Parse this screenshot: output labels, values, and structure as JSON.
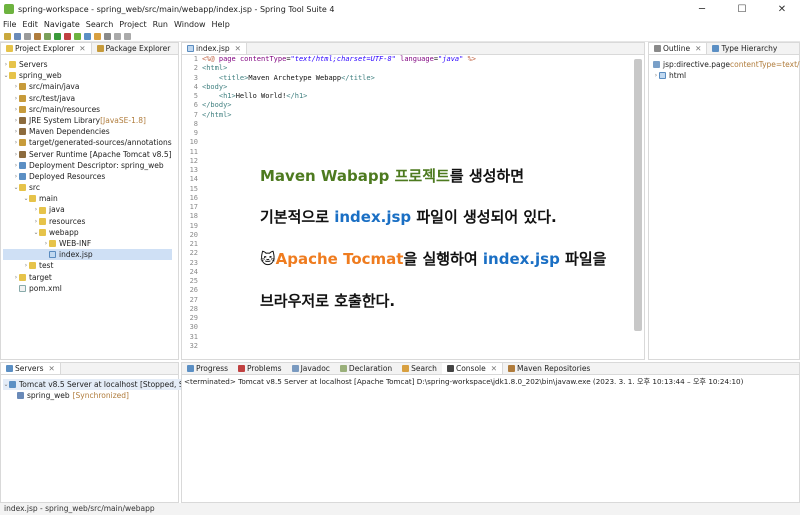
{
  "window": {
    "title": "spring-workspace - spring_web/src/main/webapp/index.jsp - Spring Tool Suite 4",
    "min": "─",
    "max": "☐",
    "close": "✕"
  },
  "menu": [
    "File",
    "Edit",
    "Navigate",
    "Search",
    "Project",
    "Run",
    "Window",
    "Help"
  ],
  "left_panel": {
    "tabs": [
      "Project Explorer",
      "Package Explorer"
    ],
    "tree": [
      {
        "label": "Servers",
        "depth": 0,
        "arrow": "›",
        "icon": "fold"
      },
      {
        "label": "spring_web",
        "depth": 0,
        "arrow": "⌄",
        "icon": "fold"
      },
      {
        "label": "src/main/java",
        "depth": 1,
        "arrow": "›",
        "icon": "pkg"
      },
      {
        "label": "src/test/java",
        "depth": 1,
        "arrow": "›",
        "icon": "pkg"
      },
      {
        "label": "src/main/resources",
        "depth": 1,
        "arrow": "›",
        "icon": "pkg"
      },
      {
        "label": "JRE System Library",
        "suffix": "[JavaSE-1.8]",
        "depth": 1,
        "arrow": "›",
        "icon": "lib"
      },
      {
        "label": "Maven Dependencies",
        "depth": 1,
        "arrow": "›",
        "icon": "lib"
      },
      {
        "label": "target/generated-sources/annotations",
        "depth": 1,
        "arrow": "›",
        "icon": "pkg"
      },
      {
        "label": "Server Runtime [Apache Tomcat v8.5]",
        "depth": 1,
        "arrow": "›",
        "icon": "lib"
      },
      {
        "label": "Deployment Descriptor: spring_web",
        "depth": 1,
        "arrow": "›",
        "icon": "srv"
      },
      {
        "label": "Deployed Resources",
        "depth": 1,
        "arrow": "›",
        "icon": "srv"
      },
      {
        "label": "src",
        "depth": 1,
        "arrow": "⌄",
        "icon": "fold"
      },
      {
        "label": "main",
        "depth": 2,
        "arrow": "⌄",
        "icon": "fold"
      },
      {
        "label": "java",
        "depth": 3,
        "arrow": "›",
        "icon": "fold"
      },
      {
        "label": "resources",
        "depth": 3,
        "arrow": "›",
        "icon": "fold"
      },
      {
        "label": "webapp",
        "depth": 3,
        "arrow": "⌄",
        "icon": "fold"
      },
      {
        "label": "WEB-INF",
        "depth": 4,
        "arrow": "›",
        "icon": "fold"
      },
      {
        "label": "index.jsp",
        "depth": 4,
        "arrow": "",
        "icon": "jsp",
        "selected": true
      },
      {
        "label": "test",
        "depth": 2,
        "arrow": "›",
        "icon": "fold"
      },
      {
        "label": "target",
        "depth": 1,
        "arrow": "›",
        "icon": "fold"
      },
      {
        "label": "pom.xml",
        "depth": 1,
        "arrow": "",
        "icon": "file"
      }
    ]
  },
  "editor": {
    "tab": "index.jsp",
    "line_numbers": [
      "1",
      "2",
      "3",
      "4",
      "5",
      "6",
      "7",
      "8",
      "9",
      "10",
      "11",
      "12",
      "13",
      "14",
      "15",
      "16",
      "17",
      "18",
      "19",
      "20",
      "21",
      "22",
      "23",
      "24",
      "25",
      "26",
      "27",
      "28",
      "29",
      "30",
      "31",
      "32"
    ]
  },
  "overlay_text": {
    "line1_a": "Maven Wabapp",
    "line1_b": " 프로젝트",
    "line1_c": "를 생성하면",
    "line2_a": "기본적으로 ",
    "line2_b": "index.jsp",
    "line2_c": " 파일이 생성되어 있다.",
    "line3_emoji": "🐱",
    "line3_a": "Apache Tocmat",
    "line3_b": "을 실행하여 ",
    "line3_c": "index.jsp",
    "line3_d": " 파일을",
    "line4": "브라우저로 호출한다."
  },
  "outline_panel": {
    "tabs": [
      "Outline",
      "Type Hierarchy"
    ],
    "items": [
      {
        "label": "jsp:directive.page",
        "suffix": " contentType=text/h"
      },
      {
        "label": "html"
      }
    ]
  },
  "servers_panel": {
    "tab": "Servers",
    "server": "Tomcat v8.5 Server at localhost  [Stopped, Synch",
    "child": "spring_web",
    "child_status": "[Synchronized]"
  },
  "console_panel": {
    "tabs": [
      "Progress",
      "Problems",
      "Javadoc",
      "Declaration",
      "Search",
      "Console",
      "Maven Repositories"
    ],
    "text": "<terminated> Tomcat v8.5 Server at localhost [Apache Tomcat] D:\\spring-workspace\\jdk1.8.0_202\\bin\\javaw.exe  (2023. 3. 1. 오후 10:13:44 – 오후 10:24:10)"
  },
  "status_bar": "index.jsp - spring_web/src/main/webapp",
  "colors": {
    "accent_green": "#4d7a1f",
    "accent_blue": "#1a6fc4",
    "accent_orange": "#ef7c1f"
  }
}
